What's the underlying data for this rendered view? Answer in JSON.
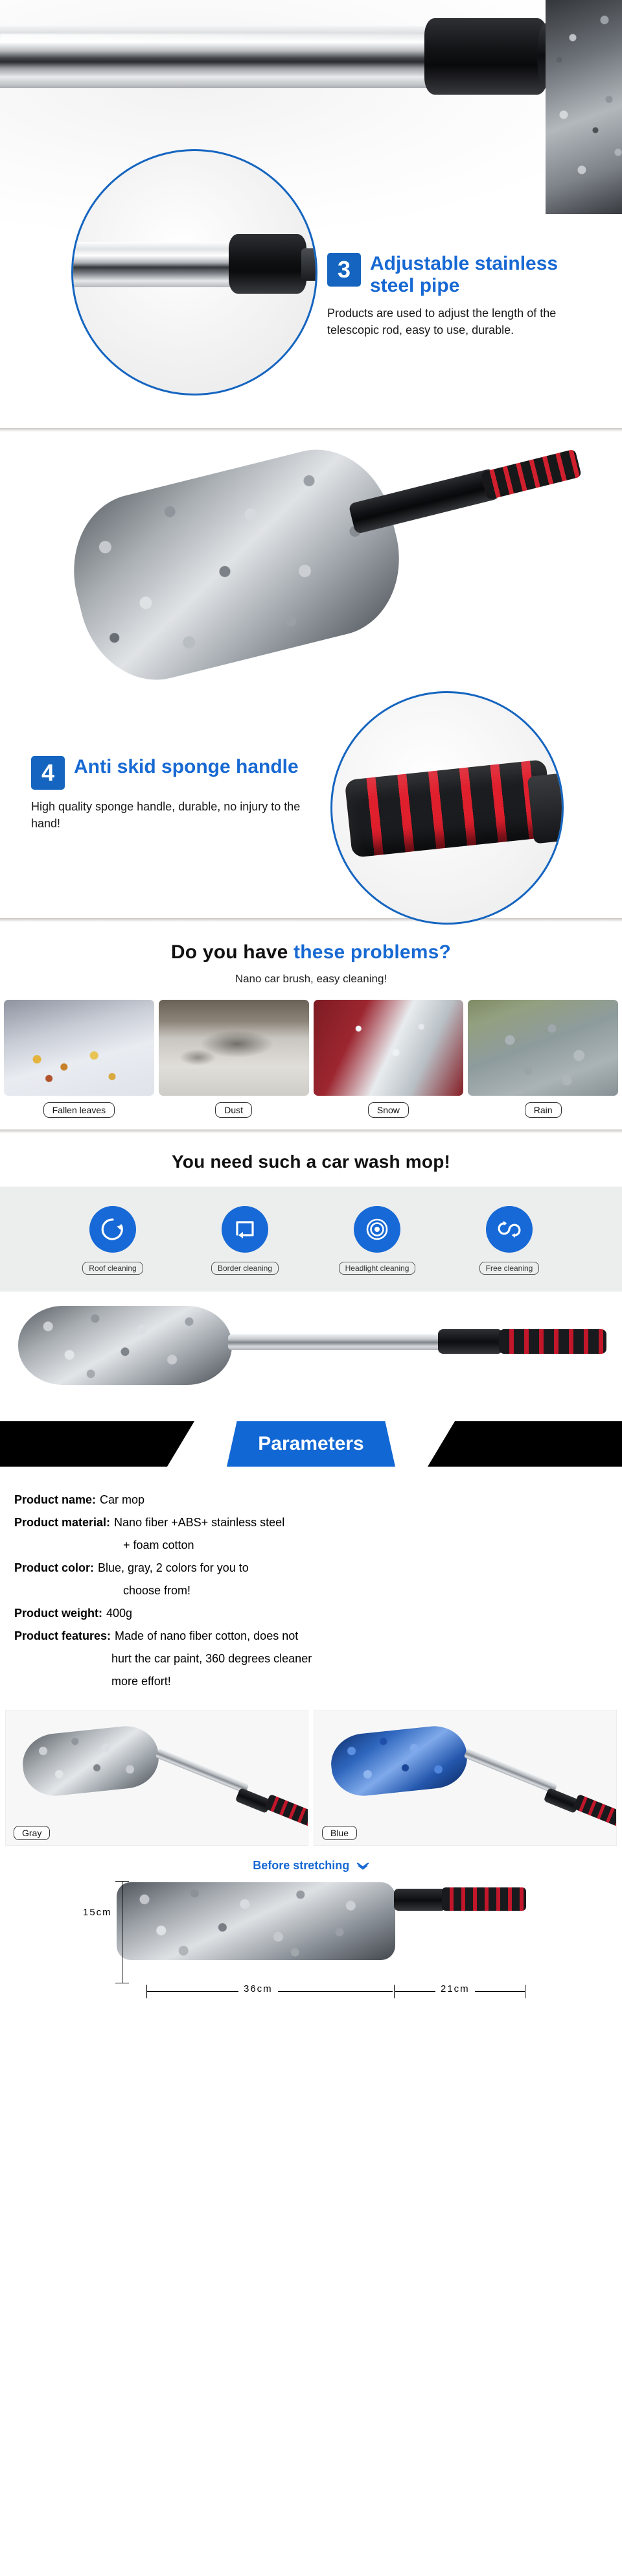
{
  "features": [
    {
      "number": "3",
      "title": "Adjustable stainless steel pipe",
      "desc": "Products are used to adjust the length of the telescopic rod, easy to use, durable."
    },
    {
      "number": "4",
      "title": "Anti skid sponge handle",
      "desc": "High quality sponge handle, durable, no injury to the hand!"
    }
  ],
  "problems": {
    "heading_black": "Do you have ",
    "heading_blue": "these problems?",
    "subtitle": "Nano car brush, easy cleaning!",
    "items": [
      {
        "label": "Fallen leaves",
        "image": "car-covered-in-fallen-leaves"
      },
      {
        "label": "Dust",
        "image": "dusty-car-window-with-writing"
      },
      {
        "label": "Snow",
        "image": "snow-covered-red-car"
      },
      {
        "label": "Rain",
        "image": "rain-droplets-on-car-surface"
      }
    ]
  },
  "need": {
    "heading": "You need such a car wash mop!",
    "icons": [
      {
        "label": "Roof cleaning",
        "icon": "circular-arrow-icon"
      },
      {
        "label": "Border cleaning",
        "icon": "square-arrow-icon"
      },
      {
        "label": "Headlight cleaning",
        "icon": "concentric-target-icon"
      },
      {
        "label": "Free cleaning",
        "icon": "double-curved-arrow-icon"
      }
    ]
  },
  "parameters": {
    "banner_title": "Parameters",
    "rows": [
      {
        "key": "Product name:",
        "value": "Car mop",
        "continuation": []
      },
      {
        "key": "Product material:",
        "value": "Nano fiber +ABS+ stainless steel",
        "continuation": [
          "+ foam cotton"
        ]
      },
      {
        "key": "Product color:",
        "value": "Blue, gray, 2 colors for you to",
        "continuation": [
          "choose from!"
        ]
      },
      {
        "key": "Product weight:",
        "value": "400g",
        "continuation": []
      },
      {
        "key": "Product features:",
        "value": "Made of nano fiber cotton, does not",
        "continuation": [
          "hurt the car paint, 360 degrees cleaner",
          "more effort!"
        ]
      }
    ]
  },
  "colors": {
    "variants": [
      {
        "label": "Gray",
        "swatch": "#9aa0a6"
      },
      {
        "label": "Blue",
        "swatch": "#2e66bd"
      }
    ]
  },
  "stretch": {
    "title": "Before stretching",
    "chevron": "chevron-down-icon",
    "height_label": "15cm",
    "brush_label": "36cm",
    "handle_label": "21cm"
  },
  "theme": {
    "brand_blue": "#1769d3",
    "badge_blue": "#1565c0",
    "icon_blue": "#1669d6",
    "band_black": "#000000",
    "grip_red": "#c2162a"
  }
}
